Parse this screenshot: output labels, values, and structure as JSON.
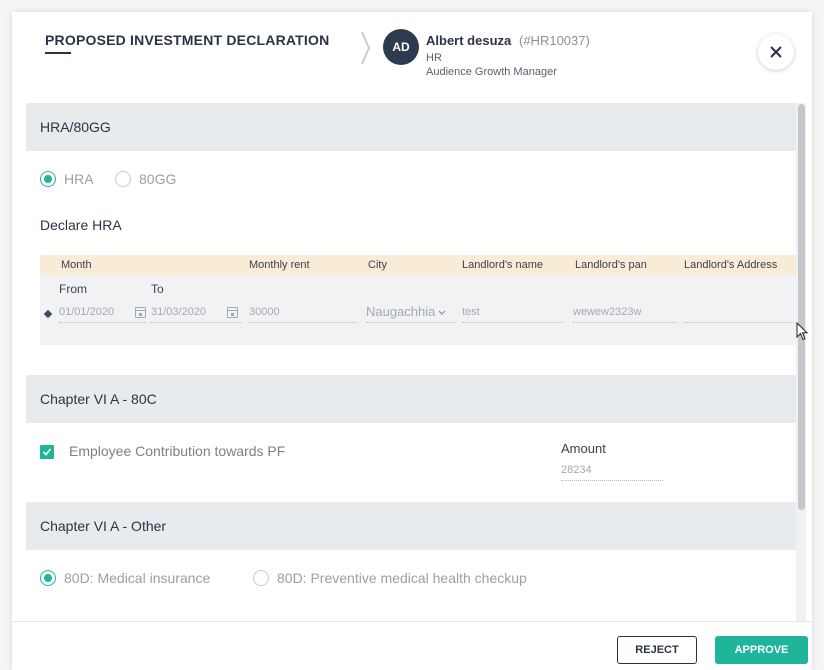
{
  "header": {
    "title": "PROPOSED INVESTMENT DECLARATION",
    "employee": {
      "initials": "AD",
      "name": "Albert desuza",
      "id": "(#HR10037)",
      "department": "HR",
      "role": "Audience Growth Manager"
    }
  },
  "sections": {
    "hra": {
      "title": "HRA/80GG",
      "options": [
        "HRA",
        "80GG"
      ],
      "selected": "HRA",
      "subheading": "Declare HRA",
      "table": {
        "columns": [
          "Month",
          "Monthly rent",
          "City",
          "Landlord's name",
          "Landlord's pan",
          "Landlord's Address"
        ],
        "sub_labels": {
          "from": "From",
          "to": "To"
        },
        "row": {
          "from": "01/01/2020",
          "to": "31/03/2020",
          "rent": "30000",
          "city": "Naugachhia",
          "landlord_name": "test",
          "landlord_pan": "wewew2323w",
          "landlord_address": ""
        }
      }
    },
    "c80": {
      "title": "Chapter VI A - 80C",
      "item_label": "Employee Contribution towards PF",
      "checked": true,
      "amount_label": "Amount",
      "amount_value": "28234"
    },
    "other": {
      "title": "Chapter VI A - Other",
      "options": [
        "80D: Medical insurance",
        "80D: Preventive medical health checkup"
      ],
      "selected": "80D: Medical insurance"
    }
  },
  "footer": {
    "reject_label": "REJECT",
    "approve_label": "APPROVE"
  },
  "colors": {
    "accent": "#1fb59a",
    "section_bg": "#e8ebee",
    "table_header_bg": "#f9ecd6",
    "avatar_bg": "#2e3a4e"
  }
}
